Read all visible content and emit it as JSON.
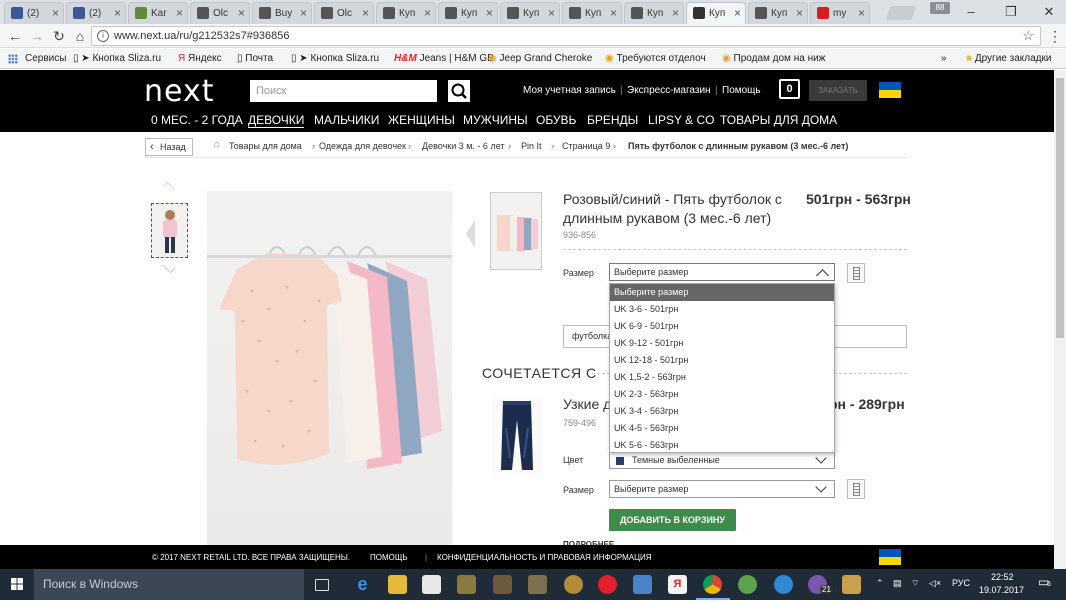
{
  "browser": {
    "tabs": [
      {
        "title": "(2)",
        "color": "#3b5998"
      },
      {
        "title": "(2)",
        "color": "#3b5998"
      },
      {
        "title": "Kar",
        "color": "#5b8d3a"
      },
      {
        "title": "Olc",
        "color": "#555555"
      },
      {
        "title": "Buy",
        "color": "#555555"
      },
      {
        "title": "Olc",
        "color": "#555555"
      },
      {
        "title": "Куп",
        "color": "#555555"
      },
      {
        "title": "Куп",
        "color": "#555555"
      },
      {
        "title": "Куп",
        "color": "#555555"
      },
      {
        "title": "Куп",
        "color": "#555555"
      },
      {
        "title": "Куп",
        "color": "#555555"
      },
      {
        "title": "Куп",
        "color": "#333333",
        "active": true
      },
      {
        "title": "Куп",
        "color": "#555555"
      },
      {
        "title": "my",
        "color": "#d32020"
      }
    ],
    "profile": "88",
    "url": "www.next.ua/ru/g212532s7#936856",
    "bookmarks": [
      "Сервисы",
      "Кнопка Sliza.ru",
      "Яндекс",
      "Почта",
      "Кнопка Sliza.ru",
      "Jeans | H&M GB",
      "Jeep Grand Cheroke",
      "Требуются отделоч",
      "Продам дом на ниж"
    ],
    "bookmarks_more": "»",
    "other_bookmarks": "Другие закладки"
  },
  "header": {
    "logo": "next",
    "search_placeholder": "Поиск",
    "links": [
      "Моя учетная запись",
      "Экспресс-магазин",
      "Помощь"
    ],
    "bag_count": "0",
    "order_label": "ЗАКАЗАТЬ",
    "categories": [
      "0 МЕС. - 2 ГОДА",
      "ДЕВОЧКИ",
      "МАЛЬЧИКИ",
      "ЖЕНЩИНЫ",
      "МУЖЧИНЫ",
      "ОБУВЬ",
      "БРЕНДЫ",
      "LIPSY & CO",
      "ТОВАРЫ ДЛЯ ДОМА"
    ],
    "selected_category": "ДЕВОЧКИ"
  },
  "breadcrumb": {
    "back": "Назад",
    "items": [
      "Товары для дома",
      "Одежда для девочек",
      "Девочки 3 м. - 6 лет",
      "Pin It",
      "Страница 9",
      "Пять футболок с длинным рукавом (3 мес.-6 лет)"
    ]
  },
  "product": {
    "title_color": "Розовый/синий",
    "title_rest": " - Пять футболок с длинным рукавом (3 мес.-6 лет)",
    "price_low": "501грн",
    "price_sep": " - ",
    "price_high": "563грн",
    "code": "936-856",
    "size_label": "Размер",
    "size_placeholder": "Выберите размер",
    "size_options": [
      "Выберите размер",
      "UK 3-6 - 501грн",
      "UK 6-9 - 501грн",
      "UK 9-12 - 501грн",
      "UK 12-18 - 501грн",
      "UK 1,5-2 - 563грн",
      "UK 2-3 - 563грн",
      "UK 3-4 - 563грн",
      "UK 4-5 - 563грн",
      "UK 5-6 - 563грн"
    ],
    "field_text": "футболка"
  },
  "matches": {
    "heading": "СОЧЕТАЕТСЯ С",
    "item_title": "Узкие д",
    "item_price_prefix": "рн - ",
    "item_price_high": "289грн",
    "item_code": "759-496",
    "color_label": "Цвет",
    "color_value": "Темные выбеленные",
    "size_label": "Размер",
    "size_placeholder": "Выберите размер",
    "add_to_cart": "ДОБАВИТЬ В КОРЗИНУ",
    "more": "ПОДРОБНЕЕ"
  },
  "footer": {
    "copyright": "© 2017 NEXT RETAIL LTD. ВСЕ ПРАВА ЗАЩИЩЕНЫ.",
    "help": "ПОМОЩЬ",
    "privacy": "КОНФИДЕНЦИАЛЬНОСТЬ И ПРАВОВАЯ ИНФОРМАЦИЯ"
  },
  "taskbar": {
    "search_placeholder": "Поиск в Windows",
    "viber_badge": "21",
    "language": "РУС",
    "time": "22:52",
    "date": "19.07.2017",
    "notifications": "6"
  },
  "colors": {
    "header_bg": "#000000",
    "add_to_cart": "#3d8c4a",
    "flag_blue": "#0057b7",
    "flag_yellow": "#ffd700"
  }
}
